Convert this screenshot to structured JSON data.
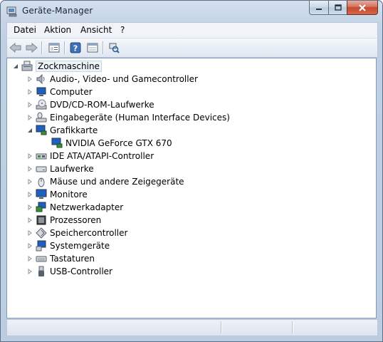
{
  "window": {
    "title": "Geräte-Manager"
  },
  "menu": {
    "items": [
      "Datei",
      "Aktion",
      "Ansicht",
      "?"
    ]
  },
  "toolbar": {
    "buttons": [
      "back-icon",
      "forward-icon",
      "properties-view-icon",
      "help-icon",
      "device-view-icon",
      "scan-hardware-icon"
    ]
  },
  "tree": {
    "root": "Zockmaschine",
    "categories": [
      {
        "label": "Audio-, Video- und Gamecontroller",
        "icon": "speaker-icon",
        "expanded": false
      },
      {
        "label": "Computer",
        "icon": "computer-icon",
        "expanded": false
      },
      {
        "label": "DVD/CD-ROM-Laufwerke",
        "icon": "dvd-drive-icon",
        "expanded": false
      },
      {
        "label": "Eingabegeräte (Human Interface Devices)",
        "icon": "hid-icon",
        "expanded": false
      },
      {
        "label": "Grafikkarte",
        "icon": "display-adapter-icon",
        "expanded": true,
        "children": [
          "NVIDIA GeForce GTX 670"
        ]
      },
      {
        "label": "IDE ATA/ATAPI-Controller",
        "icon": "ide-controller-icon",
        "expanded": false
      },
      {
        "label": "Laufwerke",
        "icon": "disk-drive-icon",
        "expanded": false
      },
      {
        "label": "Mäuse und andere Zeigegeräte",
        "icon": "mouse-icon",
        "expanded": false
      },
      {
        "label": "Monitore",
        "icon": "monitor-icon",
        "expanded": false
      },
      {
        "label": "Netzwerkadapter",
        "icon": "network-adapter-icon",
        "expanded": false
      },
      {
        "label": "Prozessoren",
        "icon": "processor-icon",
        "expanded": false
      },
      {
        "label": "Speichercontroller",
        "icon": "storage-controller-icon",
        "expanded": false
      },
      {
        "label": "Systemgeräte",
        "icon": "system-devices-icon",
        "expanded": false
      },
      {
        "label": "Tastaturen",
        "icon": "keyboard-icon",
        "expanded": false
      },
      {
        "label": "USB-Controller",
        "icon": "usb-icon",
        "expanded": false
      }
    ]
  }
}
